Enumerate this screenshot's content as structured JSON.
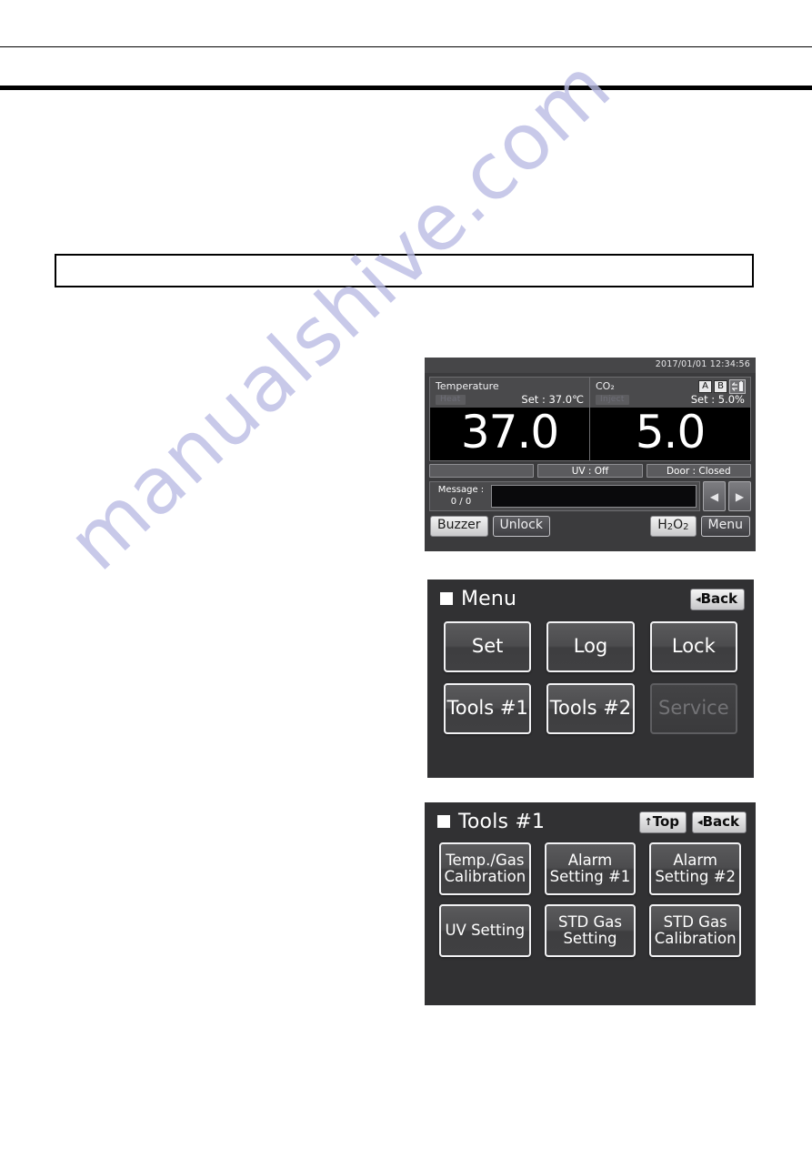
{
  "page": {
    "watermark": "manualshive.com",
    "note_box_text": ""
  },
  "main_screen": {
    "clock": "2017/01/01  12:34:56",
    "temperature": {
      "label": "Temperature",
      "state_badge": "Heat",
      "setpoint": "Set : 37.0℃",
      "value": "37.0"
    },
    "co2": {
      "label": "CO₂",
      "state_badge": "Inject",
      "setpoint": "Set :  5.0%",
      "value": "5.0",
      "bottle_a": "A",
      "bottle_b": "B",
      "tank_icon": "gas-cylinder-icon"
    },
    "status": {
      "cell1": "",
      "cell2": "UV : Off",
      "cell3": "Door : Closed"
    },
    "message": {
      "label": "Message :",
      "count": "0 / 0",
      "text": "",
      "prev_icon": "◀",
      "next_icon": "▶"
    },
    "buttons": {
      "buzzer": "Buzzer",
      "unlock": "Unlock",
      "h2o2_main": "H",
      "h2o2_sub1": "2",
      "h2o2_mid": "O",
      "h2o2_sub2": "2",
      "menu": "Menu"
    }
  },
  "menu_screen": {
    "title": "Menu",
    "back_label": "Back",
    "back_caret": "◂",
    "buttons": [
      {
        "label": "Set",
        "disabled": false
      },
      {
        "label": "Log",
        "disabled": false
      },
      {
        "label": "Lock",
        "disabled": false
      },
      {
        "label": "Tools #1",
        "disabled": false
      },
      {
        "label": "Tools #2",
        "disabled": false
      },
      {
        "label": "Service",
        "disabled": true
      }
    ]
  },
  "tools_screen": {
    "title": "Tools #1",
    "top_label": "Top",
    "top_caret": "↑",
    "back_label": "Back",
    "back_caret": "◂",
    "buttons": [
      {
        "line1": "Temp./Gas",
        "line2": "Calibration"
      },
      {
        "line1": "Alarm",
        "line2": "Setting #1"
      },
      {
        "line1": "Alarm",
        "line2": "Setting #2"
      },
      {
        "line1": "UV Setting",
        "line2": ""
      },
      {
        "line1": "STD Gas",
        "line2": "Setting"
      },
      {
        "line1": "STD Gas",
        "line2": "Calibration"
      }
    ]
  }
}
